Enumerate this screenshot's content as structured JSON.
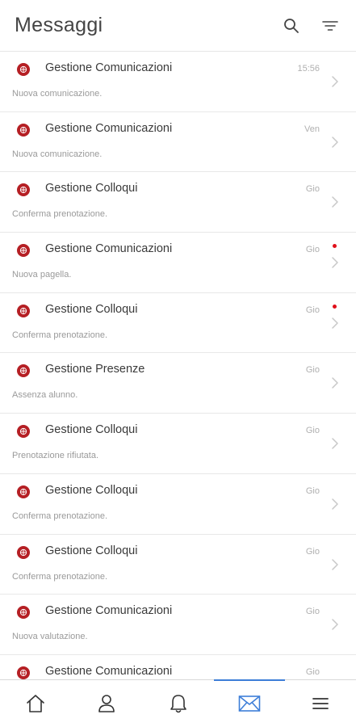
{
  "header": {
    "title": "Messaggi",
    "search_icon": "search-icon",
    "filter_icon": "filter-icon"
  },
  "colors": {
    "brand_red": "#b51f24",
    "unread_dot": "#e0101a",
    "active_tab": "#3d7ed8"
  },
  "messages": [
    {
      "sender": "Gestione Comunicazioni",
      "time": "15:56",
      "preview": "Nuova comunicazione.",
      "unread": false
    },
    {
      "sender": "Gestione Comunicazioni",
      "time": "Ven",
      "preview": "Nuova comunicazione.",
      "unread": false
    },
    {
      "sender": "Gestione Colloqui",
      "time": "Gio",
      "preview": "Conferma prenotazione.",
      "unread": false
    },
    {
      "sender": "Gestione Comunicazioni",
      "time": "Gio",
      "preview": "Nuova pagella.",
      "unread": true
    },
    {
      "sender": "Gestione Colloqui",
      "time": "Gio",
      "preview": "Conferma prenotazione.",
      "unread": true
    },
    {
      "sender": "Gestione Presenze",
      "time": "Gio",
      "preview": "Assenza alunno.",
      "unread": false
    },
    {
      "sender": "Gestione Colloqui",
      "time": "Gio",
      "preview": "Prenotazione rifiutata.",
      "unread": false
    },
    {
      "sender": "Gestione Colloqui",
      "time": "Gio",
      "preview": "Conferma prenotazione.",
      "unread": false
    },
    {
      "sender": "Gestione Colloqui",
      "time": "Gio",
      "preview": "Conferma prenotazione.",
      "unread": false
    },
    {
      "sender": "Gestione Comunicazioni",
      "time": "Gio",
      "preview": "Nuova valutazione.",
      "unread": false
    },
    {
      "sender": "Gestione Comunicazioni",
      "time": "Gio",
      "preview": "",
      "unread": false
    }
  ],
  "bottom_nav": [
    {
      "icon": "home-icon",
      "active": false
    },
    {
      "icon": "profile-icon",
      "active": false
    },
    {
      "icon": "bell-icon",
      "active": false
    },
    {
      "icon": "mail-icon",
      "active": true
    },
    {
      "icon": "menu-icon",
      "active": false
    }
  ]
}
